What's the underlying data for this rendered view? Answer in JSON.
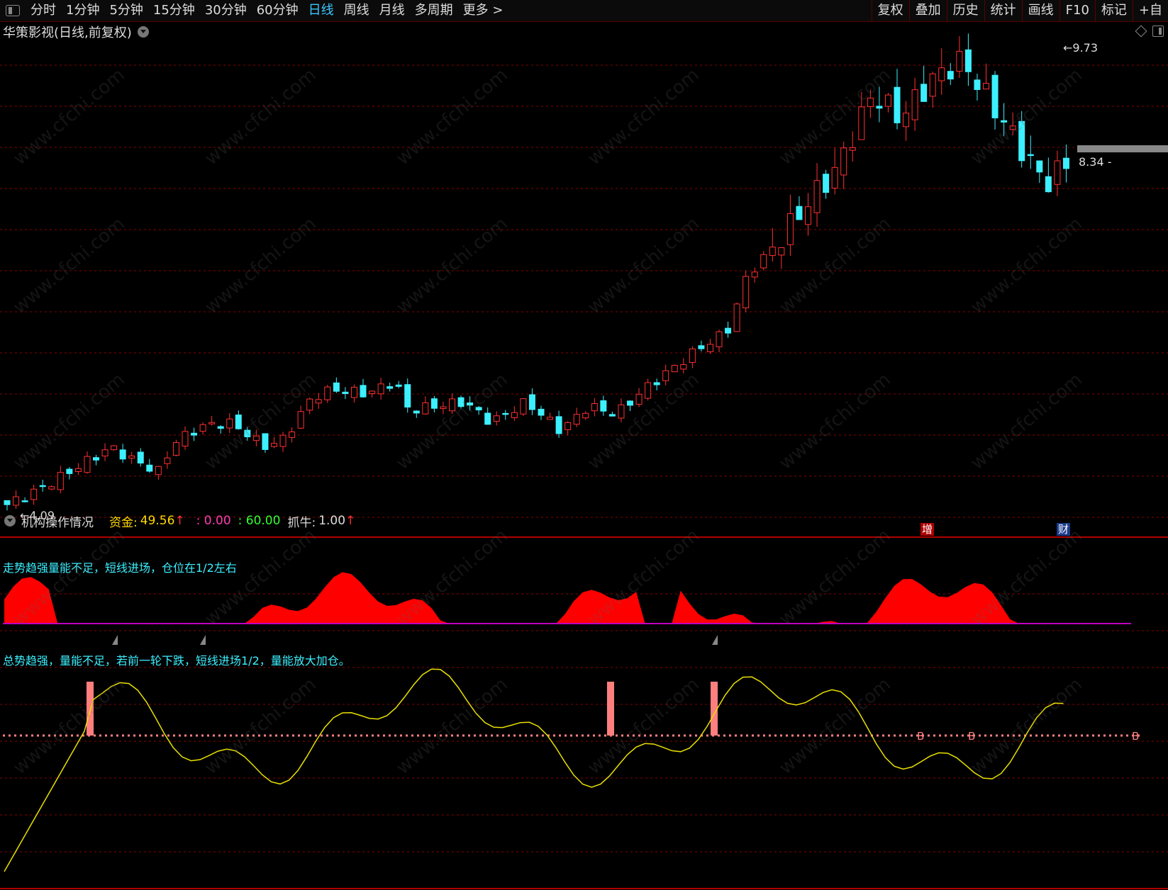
{
  "toolbar": {
    "periods": [
      "分时",
      "1分钟",
      "5分钟",
      "15分钟",
      "30分钟",
      "60分钟",
      "日线",
      "周线",
      "月线",
      "多周期",
      "更多 >"
    ],
    "active_period": "日线",
    "right_buttons": [
      "复权",
      "叠加",
      "历史",
      "统计",
      "画线",
      "F10",
      "标记",
      "+自"
    ]
  },
  "chart": {
    "title": "华策影视(日线,前复权)",
    "high_label": "9.73",
    "low_label": "4.09",
    "last_price": "8.34",
    "events": [
      "增",
      "财"
    ]
  },
  "indicator": {
    "name": "机构操作情况",
    "fund_label": "资金:",
    "fund_value": "49.56",
    "line_a": ": 0.00",
    "line_b": ": 60.00",
    "grab_label": "抓牛:",
    "grab_value": "1.00",
    "text_upper": "走势趋强量能不足，短线进场，仓位在1/2左右",
    "text_lower": "总势趋强，量能不足，若前一轮下跌，短线进场1/2，量能放大加仓。",
    "buy_marker": "B"
  },
  "watermark": "www.cfchi.com",
  "colors": {
    "up": "#ff3030",
    "down": "#3cf0ff",
    "grid": "#8a0000",
    "fill": "#ff0000",
    "yellow_line": "#e8e000",
    "magenta_line": "#c000c0",
    "pink_bar": "#ff7f7f"
  }
}
